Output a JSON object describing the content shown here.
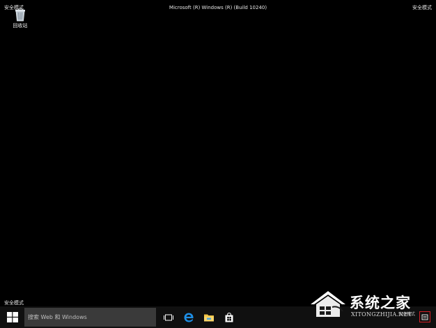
{
  "desktop": {
    "safe_mode_top_left": "安全模式",
    "safe_mode_top_right": "安全模式",
    "safe_mode_bottom_left": "安全模式",
    "build_title": "Microsoft (R) Windows (R) (Build 10240)",
    "recycle_bin_label": "回收站"
  },
  "taskbar": {
    "search_placeholder": "搜索 Web 和 Windows",
    "icons": [
      "windows-start-icon",
      "task-view-icon",
      "edge-icon",
      "file-explorer-icon",
      "store-icon"
    ],
    "tray_text": "安全模式"
  },
  "watermark": {
    "title": "系统之家",
    "url": "XITONGZHIJIA.NET"
  },
  "colors": {
    "desktop_bg": "#000000",
    "taskbar_bg": "#101010",
    "search_bg": "#3a3a3a",
    "edge_blue": "#1e8fe6",
    "explorer_yellow": "#f0c243",
    "highlight_red": "#d31f26"
  }
}
